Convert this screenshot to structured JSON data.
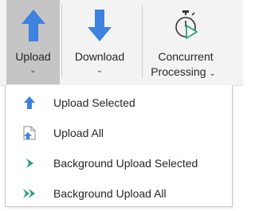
{
  "ribbon": {
    "upload": {
      "label": "Upload",
      "dropdown": "⌄",
      "icon": "upload-arrow-icon"
    },
    "download": {
      "label": "Download",
      "dropdown": "⌄",
      "icon": "download-arrow-icon"
    },
    "concurrent": {
      "label_line1": "Concurrent",
      "label_line2": "Processing",
      "dropdown": "⌄",
      "icon": "stopwatch-play-icon"
    }
  },
  "menu": {
    "items": [
      {
        "label": "Upload Selected",
        "icon": "upload-arrow-icon"
      },
      {
        "label": "Upload All",
        "icon": "document-upload-icon"
      },
      {
        "label": "Background Upload Selected",
        "icon": "chevron-right-icon"
      },
      {
        "label": "Background Upload All",
        "icon": "double-chevron-right-icon"
      }
    ]
  },
  "colors": {
    "accent_blue": "#3f82e0",
    "accent_green": "#2e9f77",
    "selected_bg": "#c5c5c5"
  }
}
